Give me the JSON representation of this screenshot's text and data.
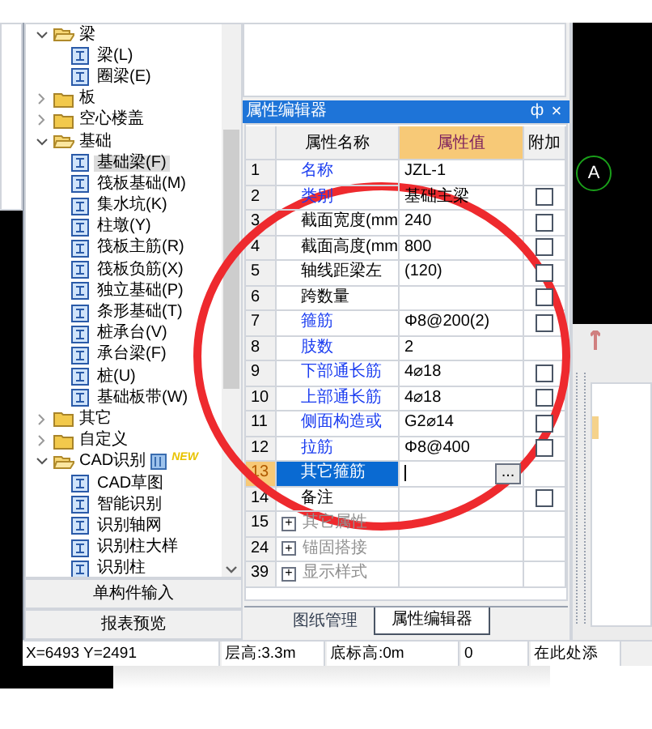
{
  "tree": [
    {
      "label": "梁",
      "expanded": true,
      "children": [
        {
          "label": "梁(L)",
          "selected": false
        },
        {
          "label": "圈梁(E)",
          "selected": false
        }
      ]
    },
    {
      "label": "板",
      "expanded": false
    },
    {
      "label": "空心楼盖",
      "expanded": false
    },
    {
      "label": "基础",
      "expanded": true,
      "children": [
        {
          "label": "基础梁(F)",
          "selected": true
        },
        {
          "label": "筏板基础(M)",
          "selected": false
        },
        {
          "label": "集水坑(K)",
          "selected": false
        },
        {
          "label": "柱墩(Y)",
          "selected": false
        },
        {
          "label": "筏板主筋(R)",
          "selected": false
        },
        {
          "label": "筏板负筋(X)",
          "selected": false
        },
        {
          "label": "独立基础(P)",
          "selected": false
        },
        {
          "label": "条形基础(T)",
          "selected": false
        },
        {
          "label": "桩承台(V)",
          "selected": false
        },
        {
          "label": "承台梁(F)",
          "selected": false
        },
        {
          "label": "桩(U)",
          "selected": false
        },
        {
          "label": "基础板带(W)",
          "selected": false
        }
      ]
    },
    {
      "label": "其它",
      "expanded": false
    },
    {
      "label": "自定义",
      "expanded": false
    },
    {
      "label": "CAD识别",
      "expanded": true,
      "badge": "NEW",
      "children": [
        {
          "label": "CAD草图",
          "selected": false
        },
        {
          "label": "智能识别",
          "selected": false
        },
        {
          "label": "识别轴网",
          "selected": false
        },
        {
          "label": "识别柱大样",
          "selected": false
        },
        {
          "label": "识别柱",
          "selected": false
        }
      ]
    }
  ],
  "side_buttons": [
    "单构件输入",
    "报表预览"
  ],
  "property_editor": {
    "title": "属性编辑器",
    "pin": "ф",
    "close": "×",
    "columns": [
      {
        "label": "属性名称",
        "selected": false
      },
      {
        "label": "属性值",
        "selected": true
      },
      {
        "label": "附加",
        "selected": false
      }
    ],
    "rows": [
      {
        "kind": "property",
        "num": "1",
        "name": "名称",
        "link": true,
        "value": "JZL-1",
        "selected": false
      },
      {
        "kind": "property",
        "num": "2",
        "name": "类别",
        "link": true,
        "value": "基础主梁",
        "checked": false,
        "selected": false
      },
      {
        "kind": "property",
        "num": "3",
        "name": "截面宽度(mm",
        "link": false,
        "value": "240",
        "checked": false,
        "selected": false
      },
      {
        "kind": "property",
        "num": "4",
        "name": "截面高度(mm",
        "link": false,
        "value": "800",
        "checked": false,
        "selected": false
      },
      {
        "kind": "property",
        "num": "5",
        "name": "轴线距梁左",
        "link": false,
        "value": "(120)",
        "checked": false,
        "selected": false
      },
      {
        "kind": "property",
        "num": "6",
        "name": "跨数量",
        "link": false,
        "checked": false,
        "selected": false
      },
      {
        "kind": "property",
        "num": "7",
        "name": "箍筋",
        "link": true,
        "value": "Φ8@200(2)",
        "checked": false,
        "selected": false
      },
      {
        "kind": "property",
        "num": "8",
        "name": "肢数",
        "link": true,
        "value": "2",
        "selected": false
      },
      {
        "kind": "property",
        "num": "9",
        "name": "下部通长筋",
        "link": true,
        "value": "4⌀18",
        "checked": false,
        "selected": false
      },
      {
        "kind": "property",
        "num": "10",
        "name": "上部通长筋",
        "link": true,
        "value": "4⌀18",
        "checked": false,
        "selected": false
      },
      {
        "kind": "property",
        "num": "11",
        "name": "侧面构造或",
        "link": true,
        "value": "G2⌀14",
        "checked": false,
        "selected": false
      },
      {
        "kind": "property",
        "num": "12",
        "name": "拉筋",
        "link": true,
        "value": "Φ8@400",
        "checked": false,
        "selected": false
      },
      {
        "kind": "property",
        "num": "13",
        "name": "其它箍筋",
        "link": true,
        "selected": true,
        "button": "..."
      },
      {
        "kind": "property",
        "num": "14",
        "name": "备注",
        "link": false,
        "checked": false,
        "selected": false
      },
      {
        "kind": "group",
        "num": "15",
        "name": "其它属性",
        "expanded": false,
        "toggle": "+"
      },
      {
        "kind": "group",
        "num": "24",
        "name": "锚固搭接",
        "expanded": false,
        "toggle": "+"
      },
      {
        "kind": "group",
        "num": "39",
        "name": "显示样式",
        "expanded": false,
        "toggle": "+"
      }
    ],
    "tabs": [
      {
        "label": "图纸管理",
        "selected": false
      },
      {
        "label": "属性编辑器",
        "selected": true
      }
    ]
  },
  "canvas": {
    "axis_label": "A"
  },
  "status_bar": [
    "X=6493 Y=2491",
    "层高:3.3m",
    "底标高:0m",
    "0",
    "在此处添"
  ],
  "annotation": {
    "kind": "circle"
  }
}
